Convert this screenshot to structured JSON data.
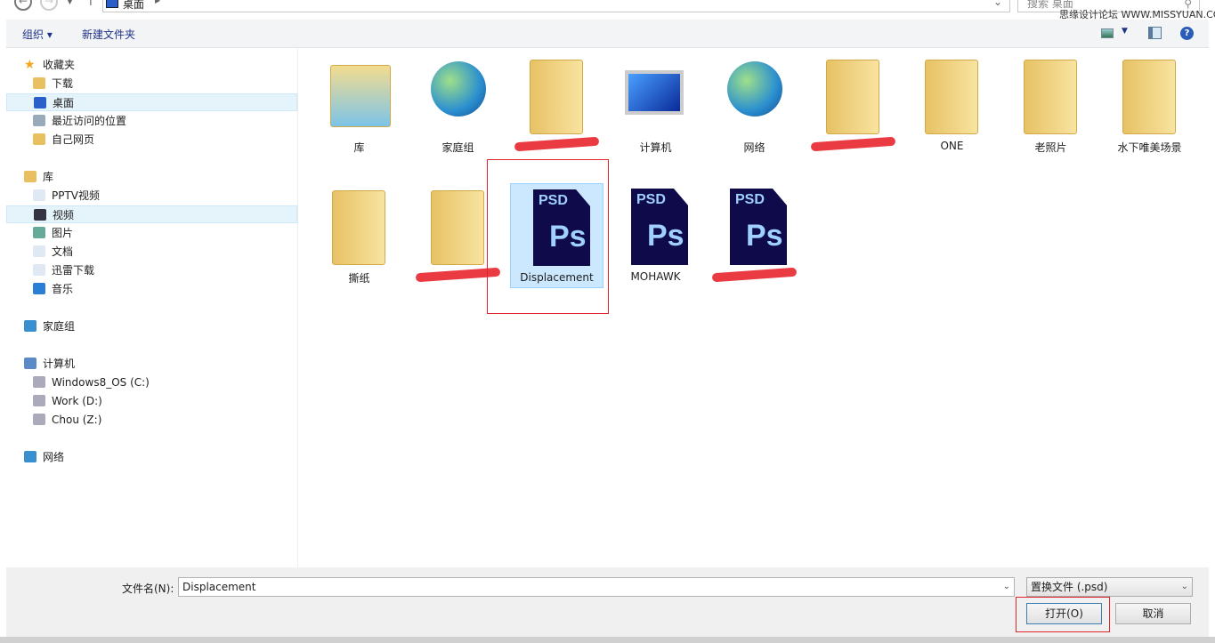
{
  "nav": {
    "address": "桌面",
    "search_placeholder": "搜索 桌面"
  },
  "watermark": "思缘设计论坛 WWW.MISSYUAN.COM",
  "toolbar": {
    "organize": "组织 ▾",
    "new_folder": "新建文件夹"
  },
  "sidebar": {
    "items": [
      {
        "label": "收藏夹",
        "level": 0,
        "icon": "star-icon"
      },
      {
        "label": "下载",
        "level": 1,
        "icon": "download-folder-icon"
      },
      {
        "label": "桌面",
        "level": 1,
        "icon": "desktop-icon",
        "selected": true
      },
      {
        "label": "最近访问的位置",
        "level": 1,
        "icon": "recent-icon"
      },
      {
        "label": "自己网页",
        "level": 1,
        "icon": "folder-icon"
      },
      {
        "label": "库",
        "level": 0,
        "icon": "library-icon"
      },
      {
        "label": "PPTV视频",
        "level": 1,
        "icon": "document-icon"
      },
      {
        "label": "视频",
        "level": 1,
        "icon": "video-icon",
        "selected": true
      },
      {
        "label": "图片",
        "level": 1,
        "icon": "picture-icon"
      },
      {
        "label": "文档",
        "level": 1,
        "icon": "document-icon"
      },
      {
        "label": "迅雷下载",
        "level": 1,
        "icon": "document-icon"
      },
      {
        "label": "音乐",
        "level": 1,
        "icon": "music-icon"
      },
      {
        "label": "家庭组",
        "level": 0,
        "icon": "homegroup-icon"
      },
      {
        "label": "计算机",
        "level": 0,
        "icon": "computer-icon"
      },
      {
        "label": "Windows8_OS (C:)",
        "level": 1,
        "icon": "drive-icon"
      },
      {
        "label": "Work (D:)",
        "level": 1,
        "icon": "drive-icon"
      },
      {
        "label": "Chou (Z:)",
        "level": 1,
        "icon": "drive-icon"
      },
      {
        "label": "网络",
        "level": 0,
        "icon": "network-icon"
      }
    ]
  },
  "files": [
    {
      "label": "库",
      "type": "library"
    },
    {
      "label": "家庭组",
      "type": "homegroup"
    },
    {
      "label": "",
      "type": "user",
      "redacted": true
    },
    {
      "label": "计算机",
      "type": "computer"
    },
    {
      "label": "网络",
      "type": "network"
    },
    {
      "label": "",
      "type": "folder",
      "redacted": true
    },
    {
      "label": "ONE",
      "type": "folder"
    },
    {
      "label": "老照片",
      "type": "folder"
    },
    {
      "label": "水下唯美场景",
      "type": "folder"
    },
    {
      "label": "撕纸",
      "type": "folder"
    },
    {
      "label": "",
      "type": "psd-folder",
      "redacted": true
    },
    {
      "label": "Displacement",
      "type": "psd",
      "selected": true
    },
    {
      "label": "MOHAWK",
      "type": "psd"
    },
    {
      "label": "",
      "type": "psd",
      "redacted": true
    }
  ],
  "bottom": {
    "filename_label": "文件名(N):",
    "filename_value": "Displacement",
    "filetype": "置换文件 (.psd)",
    "open": "打开(O)",
    "cancel": "取消"
  },
  "psd_text": {
    "tag": "PSD",
    "ps": "Ps"
  }
}
